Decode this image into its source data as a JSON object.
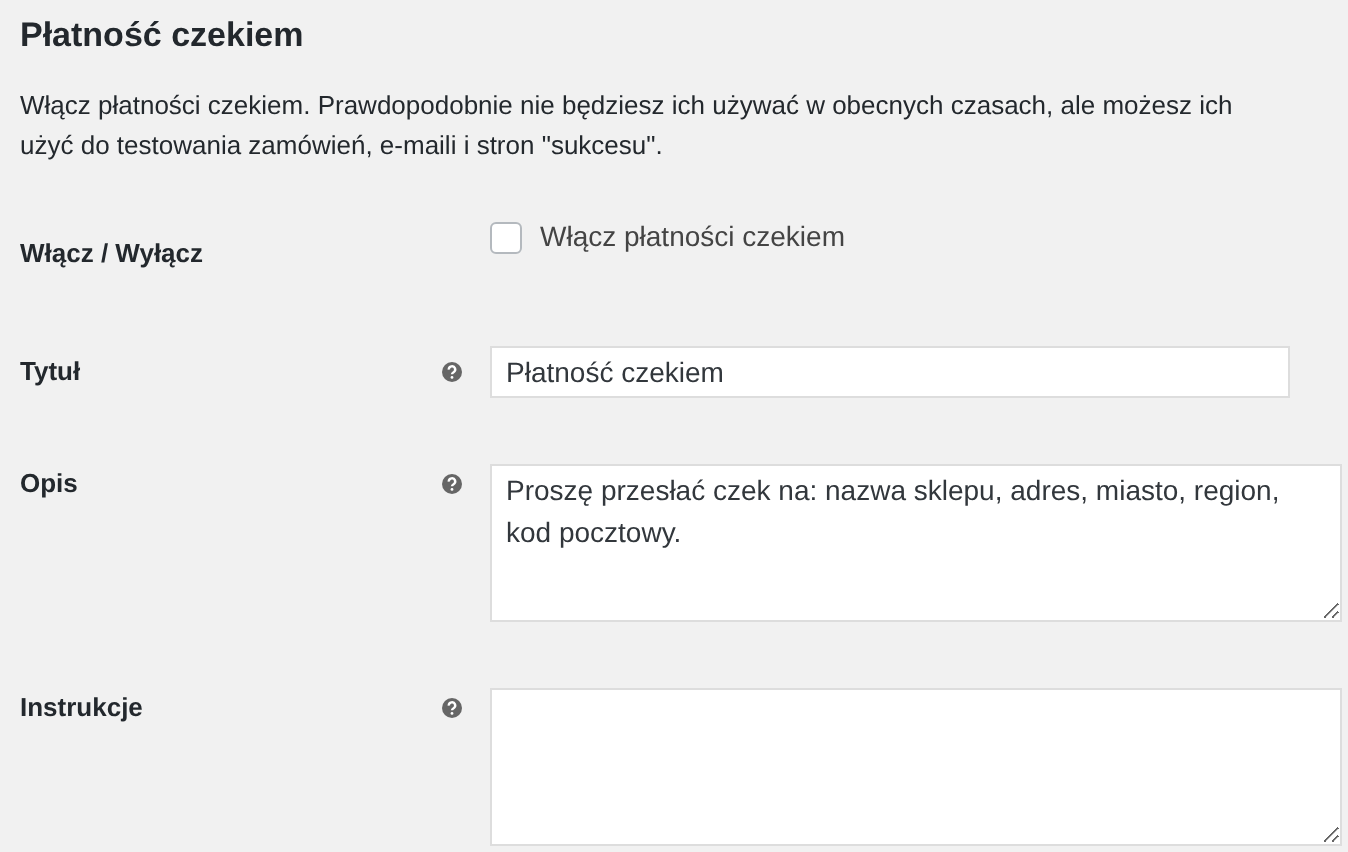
{
  "heading": "Płatność czekiem",
  "description": "Włącz płatności czekiem. Prawdopodobnie nie będziesz ich używać w obecnych czasach, ale możesz ich użyć do testowania zamówień, e-maili i stron \"sukcesu\".",
  "fields": [
    {
      "kind": "checkbox",
      "label": "Włącz / Wyłącz",
      "option": "Włącz płatności czekiem",
      "checked": false
    },
    {
      "kind": "text",
      "label": "Tytuł",
      "help": true,
      "value": "Płatność czekiem"
    },
    {
      "kind": "textarea",
      "label": "Opis",
      "help": true,
      "value": "Proszę przesłać czek na: nazwa sklepu, adres, miasto, region, kod pocztowy."
    },
    {
      "kind": "textarea",
      "label": "Instrukcje",
      "help": true
    }
  ]
}
